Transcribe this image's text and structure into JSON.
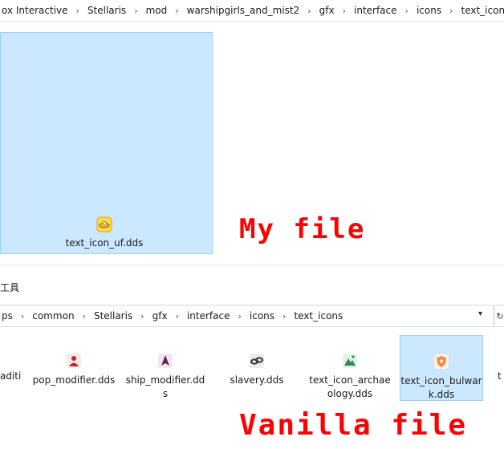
{
  "top_window": {
    "breadcrumb": [
      "ox Interactive",
      "Stellaris",
      "mod",
      "warshipgirls_and_mist2",
      "gfx",
      "interface",
      "icons",
      "text_icons"
    ],
    "files": [
      {
        "name": "text_icon_uf.dds",
        "icon": "yellow-ufo-icon"
      }
    ]
  },
  "annotations": {
    "mine": "My file",
    "vanilla": "Vanilla file"
  },
  "bottom_window": {
    "tools_label": "工具",
    "breadcrumb": [
      "ps",
      "common",
      "Stellaris",
      "gfx",
      "interface",
      "icons",
      "text_icons"
    ],
    "files": [
      {
        "name": "aditi",
        "partial": true
      },
      {
        "name": "pop_modifier.dds",
        "icon": "red-pop-icon"
      },
      {
        "name": "ship_modifier.dds",
        "icon": "purple-ship-icon"
      },
      {
        "name": "slavery.dds",
        "icon": "chain-icon"
      },
      {
        "name": "text_icon_archaeology.dds",
        "icon": "archaeology-icon"
      },
      {
        "name": "text_icon_bulwark.dds",
        "icon": "bulwark-icon",
        "selected": true
      },
      {
        "name": "t",
        "partial": true
      }
    ]
  },
  "colors": {
    "selection_fill": "#cce8ff",
    "selection_border": "#99d1ff",
    "annotation": "#ff0000"
  }
}
